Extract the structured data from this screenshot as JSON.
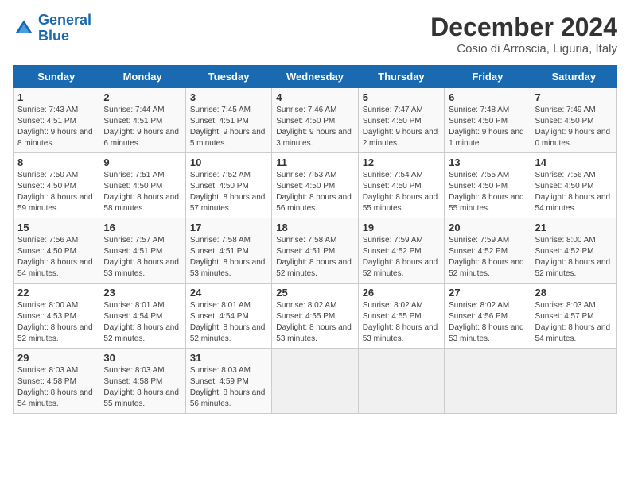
{
  "logo": {
    "line1": "General",
    "line2": "Blue"
  },
  "title": "December 2024",
  "subtitle": "Cosio di Arroscia, Liguria, Italy",
  "days_of_week": [
    "Sunday",
    "Monday",
    "Tuesday",
    "Wednesday",
    "Thursday",
    "Friday",
    "Saturday"
  ],
  "weeks": [
    [
      {
        "day": 1,
        "sunrise": "7:43 AM",
        "sunset": "4:51 PM",
        "daylight": "9 hours and 8 minutes."
      },
      {
        "day": 2,
        "sunrise": "7:44 AM",
        "sunset": "4:51 PM",
        "daylight": "9 hours and 6 minutes."
      },
      {
        "day": 3,
        "sunrise": "7:45 AM",
        "sunset": "4:51 PM",
        "daylight": "9 hours and 5 minutes."
      },
      {
        "day": 4,
        "sunrise": "7:46 AM",
        "sunset": "4:50 PM",
        "daylight": "9 hours and 3 minutes."
      },
      {
        "day": 5,
        "sunrise": "7:47 AM",
        "sunset": "4:50 PM",
        "daylight": "9 hours and 2 minutes."
      },
      {
        "day": 6,
        "sunrise": "7:48 AM",
        "sunset": "4:50 PM",
        "daylight": "9 hours and 1 minute."
      },
      {
        "day": 7,
        "sunrise": "7:49 AM",
        "sunset": "4:50 PM",
        "daylight": "9 hours and 0 minutes."
      }
    ],
    [
      {
        "day": 8,
        "sunrise": "7:50 AM",
        "sunset": "4:50 PM",
        "daylight": "8 hours and 59 minutes."
      },
      {
        "day": 9,
        "sunrise": "7:51 AM",
        "sunset": "4:50 PM",
        "daylight": "8 hours and 58 minutes."
      },
      {
        "day": 10,
        "sunrise": "7:52 AM",
        "sunset": "4:50 PM",
        "daylight": "8 hours and 57 minutes."
      },
      {
        "day": 11,
        "sunrise": "7:53 AM",
        "sunset": "4:50 PM",
        "daylight": "8 hours and 56 minutes."
      },
      {
        "day": 12,
        "sunrise": "7:54 AM",
        "sunset": "4:50 PM",
        "daylight": "8 hours and 55 minutes."
      },
      {
        "day": 13,
        "sunrise": "7:55 AM",
        "sunset": "4:50 PM",
        "daylight": "8 hours and 55 minutes."
      },
      {
        "day": 14,
        "sunrise": "7:56 AM",
        "sunset": "4:50 PM",
        "daylight": "8 hours and 54 minutes."
      }
    ],
    [
      {
        "day": 15,
        "sunrise": "7:56 AM",
        "sunset": "4:50 PM",
        "daylight": "8 hours and 54 minutes."
      },
      {
        "day": 16,
        "sunrise": "7:57 AM",
        "sunset": "4:51 PM",
        "daylight": "8 hours and 53 minutes."
      },
      {
        "day": 17,
        "sunrise": "7:58 AM",
        "sunset": "4:51 PM",
        "daylight": "8 hours and 53 minutes."
      },
      {
        "day": 18,
        "sunrise": "7:58 AM",
        "sunset": "4:51 PM",
        "daylight": "8 hours and 52 minutes."
      },
      {
        "day": 19,
        "sunrise": "7:59 AM",
        "sunset": "4:52 PM",
        "daylight": "8 hours and 52 minutes."
      },
      {
        "day": 20,
        "sunrise": "7:59 AM",
        "sunset": "4:52 PM",
        "daylight": "8 hours and 52 minutes."
      },
      {
        "day": 21,
        "sunrise": "8:00 AM",
        "sunset": "4:52 PM",
        "daylight": "8 hours and 52 minutes."
      }
    ],
    [
      {
        "day": 22,
        "sunrise": "8:00 AM",
        "sunset": "4:53 PM",
        "daylight": "8 hours and 52 minutes."
      },
      {
        "day": 23,
        "sunrise": "8:01 AM",
        "sunset": "4:54 PM",
        "daylight": "8 hours and 52 minutes."
      },
      {
        "day": 24,
        "sunrise": "8:01 AM",
        "sunset": "4:54 PM",
        "daylight": "8 hours and 52 minutes."
      },
      {
        "day": 25,
        "sunrise": "8:02 AM",
        "sunset": "4:55 PM",
        "daylight": "8 hours and 53 minutes."
      },
      {
        "day": 26,
        "sunrise": "8:02 AM",
        "sunset": "4:55 PM",
        "daylight": "8 hours and 53 minutes."
      },
      {
        "day": 27,
        "sunrise": "8:02 AM",
        "sunset": "4:56 PM",
        "daylight": "8 hours and 53 minutes."
      },
      {
        "day": 28,
        "sunrise": "8:03 AM",
        "sunset": "4:57 PM",
        "daylight": "8 hours and 54 minutes."
      }
    ],
    [
      {
        "day": 29,
        "sunrise": "8:03 AM",
        "sunset": "4:58 PM",
        "daylight": "8 hours and 54 minutes."
      },
      {
        "day": 30,
        "sunrise": "8:03 AM",
        "sunset": "4:58 PM",
        "daylight": "8 hours and 55 minutes."
      },
      {
        "day": 31,
        "sunrise": "8:03 AM",
        "sunset": "4:59 PM",
        "daylight": "8 hours and 56 minutes."
      },
      null,
      null,
      null,
      null
    ]
  ]
}
